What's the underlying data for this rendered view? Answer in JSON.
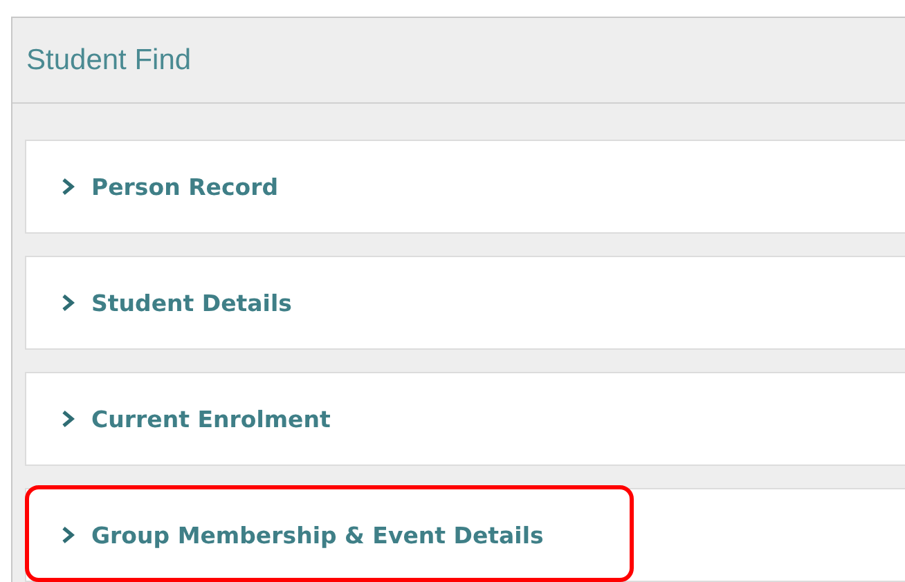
{
  "window": {
    "title": "Student Find"
  },
  "sections": [
    {
      "label": "Person Record",
      "expanded": false,
      "highlighted": false
    },
    {
      "label": "Student Details",
      "expanded": false,
      "highlighted": false
    },
    {
      "label": "Current Enrolment",
      "expanded": false,
      "highlighted": false
    },
    {
      "label": "Group Membership & Event Details",
      "expanded": false,
      "highlighted": true
    }
  ]
}
